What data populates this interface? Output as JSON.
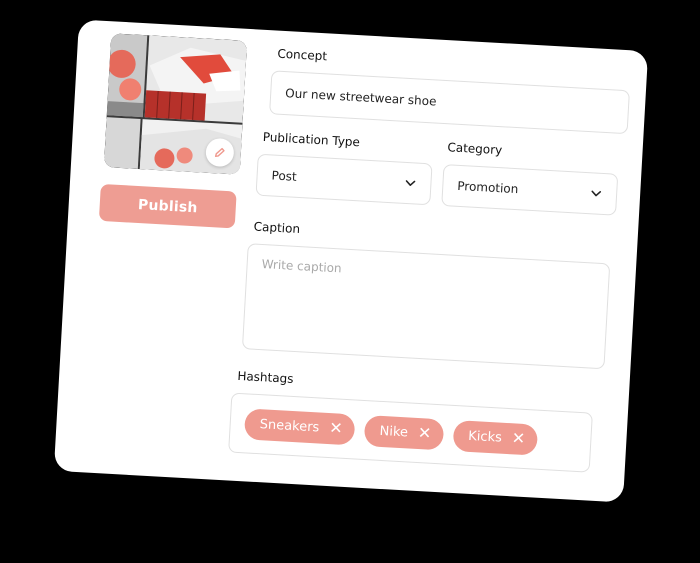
{
  "theme": {
    "accent": "#ef9a8f",
    "publish_bg": "#ee9d93"
  },
  "media": {
    "edit_icon": "pencil-icon"
  },
  "actions": {
    "publish_label": "Publish"
  },
  "concept": {
    "label": "Concept",
    "value": "Our new streetwear shoe"
  },
  "publication_type": {
    "label": "Publication Type",
    "selected": "Post"
  },
  "category": {
    "label": "Category",
    "selected": "Promotion"
  },
  "caption": {
    "label": "Caption",
    "placeholder": "Write caption"
  },
  "hashtags": {
    "label": "Hashtags",
    "items": [
      {
        "text": "Sneakers"
      },
      {
        "text": "Nike"
      },
      {
        "text": "Kicks"
      }
    ],
    "remove_icon": "close-icon"
  }
}
